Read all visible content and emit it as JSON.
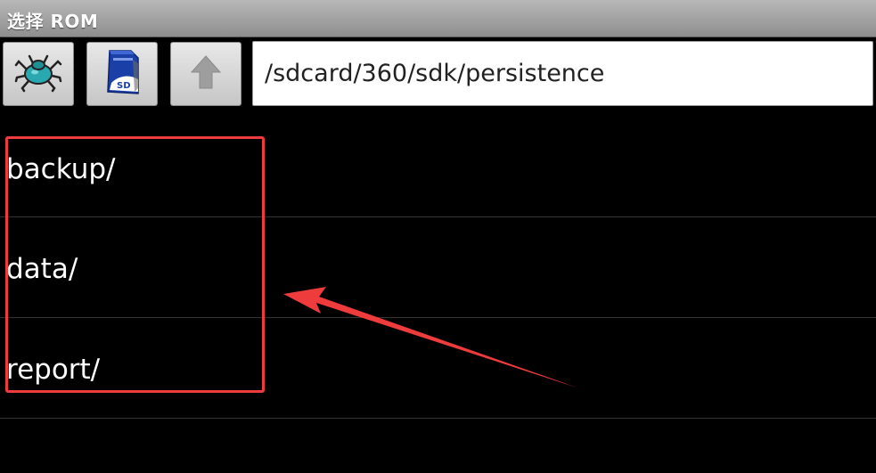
{
  "window": {
    "title": "选择 ROM"
  },
  "toolbar": {
    "buttons": [
      {
        "icon": "bug-icon"
      },
      {
        "icon": "sd-card-icon"
      },
      {
        "icon": "up-arrow-icon"
      }
    ],
    "path": "/sdcard/360/sdk/persistence"
  },
  "file_list": {
    "items": [
      {
        "name": "backup/"
      },
      {
        "name": "data/"
      },
      {
        "name": "report/"
      }
    ]
  },
  "annotation": {
    "color": "#ee3b3b"
  }
}
